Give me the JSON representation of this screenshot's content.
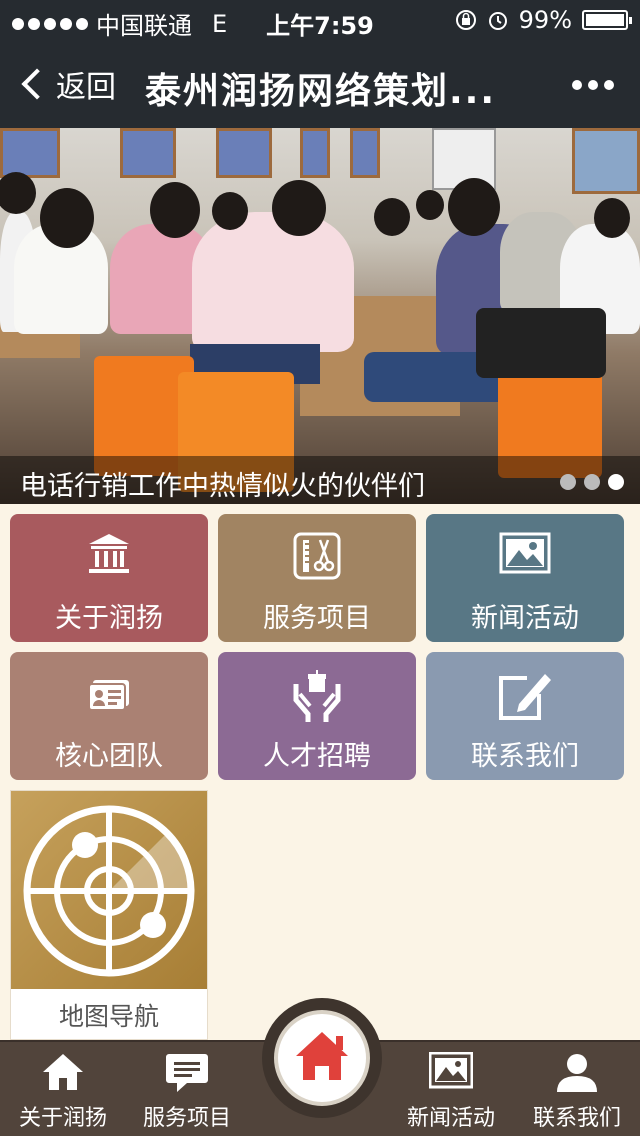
{
  "status_bar": {
    "carrier": "中国联通",
    "network": "E",
    "time": "上午7:59",
    "battery": "99%"
  },
  "nav": {
    "back_label": "返回",
    "title": "泰州润扬网络策划..."
  },
  "banner": {
    "caption": "电话行销工作中热情似火的伙伴们",
    "slide_count": 3,
    "active_slide": 3
  },
  "tiles": [
    {
      "label": "关于润扬",
      "icon": "building-icon",
      "color": "#a85a5e"
    },
    {
      "label": "服务项目",
      "icon": "scissors-icon",
      "color": "#a18462"
    },
    {
      "label": "新闻活动",
      "icon": "image-icon",
      "color": "#587785"
    },
    {
      "label": "核心团队",
      "icon": "id-card-icon",
      "color": "#aa8173"
    },
    {
      "label": "人才招聘",
      "icon": "hands-gift-icon",
      "color": "#8c6a94"
    },
    {
      "label": "联系我们",
      "icon": "edit-icon",
      "color": "#8a9ab0"
    }
  ],
  "map_tile": {
    "label": "地图导航",
    "icon": "radar-icon"
  },
  "tabbar": {
    "items": [
      {
        "label": "关于润扬",
        "icon": "home-icon"
      },
      {
        "label": "服务项目",
        "icon": "chat-icon"
      },
      {
        "label": "新闻活动",
        "icon": "image-icon"
      },
      {
        "label": "联系我们",
        "icon": "user-icon"
      }
    ],
    "center_icon": "home-icon",
    "center_color": "#e0413b"
  }
}
